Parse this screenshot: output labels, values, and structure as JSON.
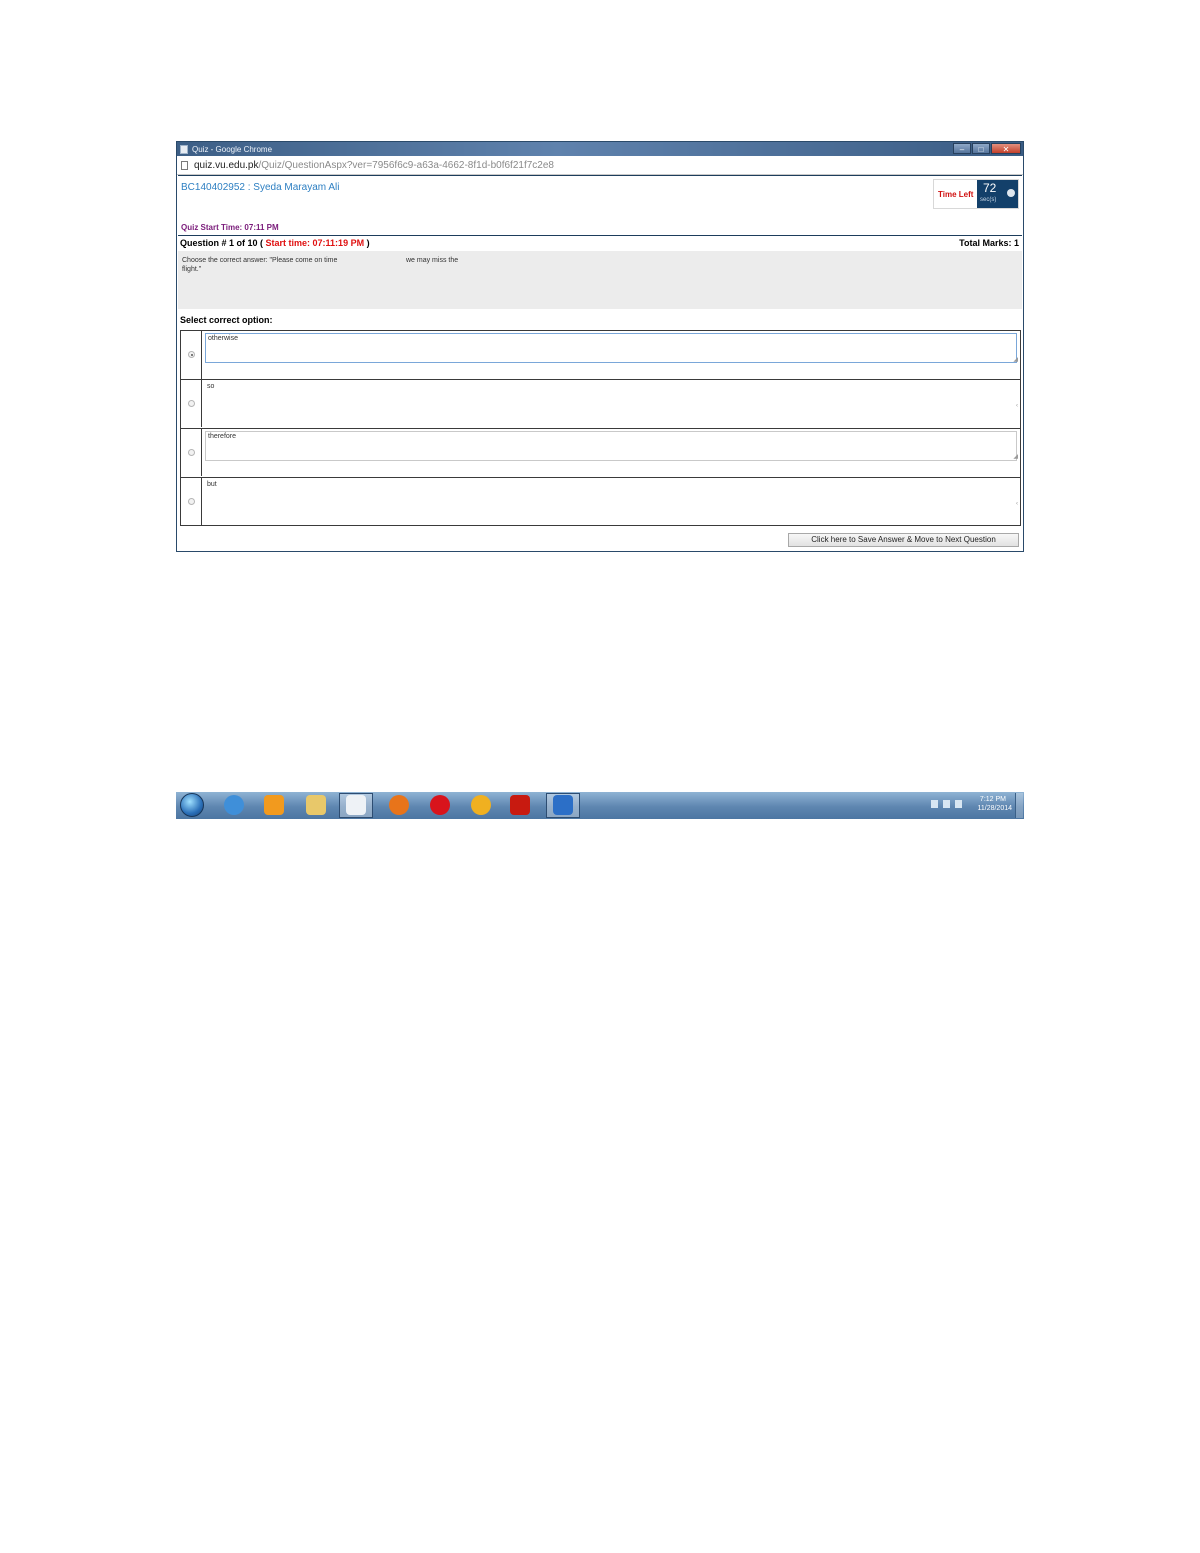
{
  "window": {
    "title": "Quiz - Google Chrome",
    "controls": {
      "minimize": "–",
      "maximize": "□",
      "close": "✕"
    }
  },
  "address_bar": {
    "host": "quiz.vu.edu.pk",
    "path": "/Quiz/QuestionAspx?ver=7956f6c9-a63a-4662-8f1d-b0f6f21f7c2e8"
  },
  "header": {
    "student": "BC140402952 : Syeda Marayam Ali",
    "quiz_start": "Quiz Start Time: 07:11 PM",
    "time_left_label": "Time Left",
    "time_left_value": "72",
    "time_left_unit": "sec(s)"
  },
  "question": {
    "number_label": "Question # 1 of 10 ( ",
    "start_time": "Start time: 07:11:19 PM",
    "close_paren": " )",
    "total_marks": "Total Marks: 1",
    "text_part1": "Choose the correct answer: \"Please come on time",
    "text_part2": "we may miss the",
    "text_line2": "flight.\""
  },
  "select_label": "Select correct option:",
  "options": [
    {
      "text": "otherwise",
      "selected": true
    },
    {
      "text": "so",
      "selected": false
    },
    {
      "text": "therefore",
      "selected": false
    },
    {
      "text": "but",
      "selected": false
    }
  ],
  "save_button": "Click here to Save Answer & Move to Next Question",
  "taskbar": {
    "pinned_icons": [
      {
        "name": "internet-explorer-icon",
        "color": "#3f8fd9"
      },
      {
        "name": "media-player-icon",
        "color": "#f29a1e"
      },
      {
        "name": "file-explorer-icon",
        "color": "#e8c86a"
      },
      {
        "name": "document-viewer-icon",
        "color": "#eef2f6"
      },
      {
        "name": "firefox-icon",
        "color": "#e8741a"
      },
      {
        "name": "opera-icon",
        "color": "#d8141c"
      },
      {
        "name": "photo-gallery-icon",
        "color": "#f0b020"
      },
      {
        "name": "acrobat-reader-icon",
        "color": "#c81a10"
      },
      {
        "name": "word-icon",
        "color": "#2c6fc7"
      }
    ],
    "tray": {
      "time": "7:12 PM",
      "date": "11/28/2014"
    }
  }
}
